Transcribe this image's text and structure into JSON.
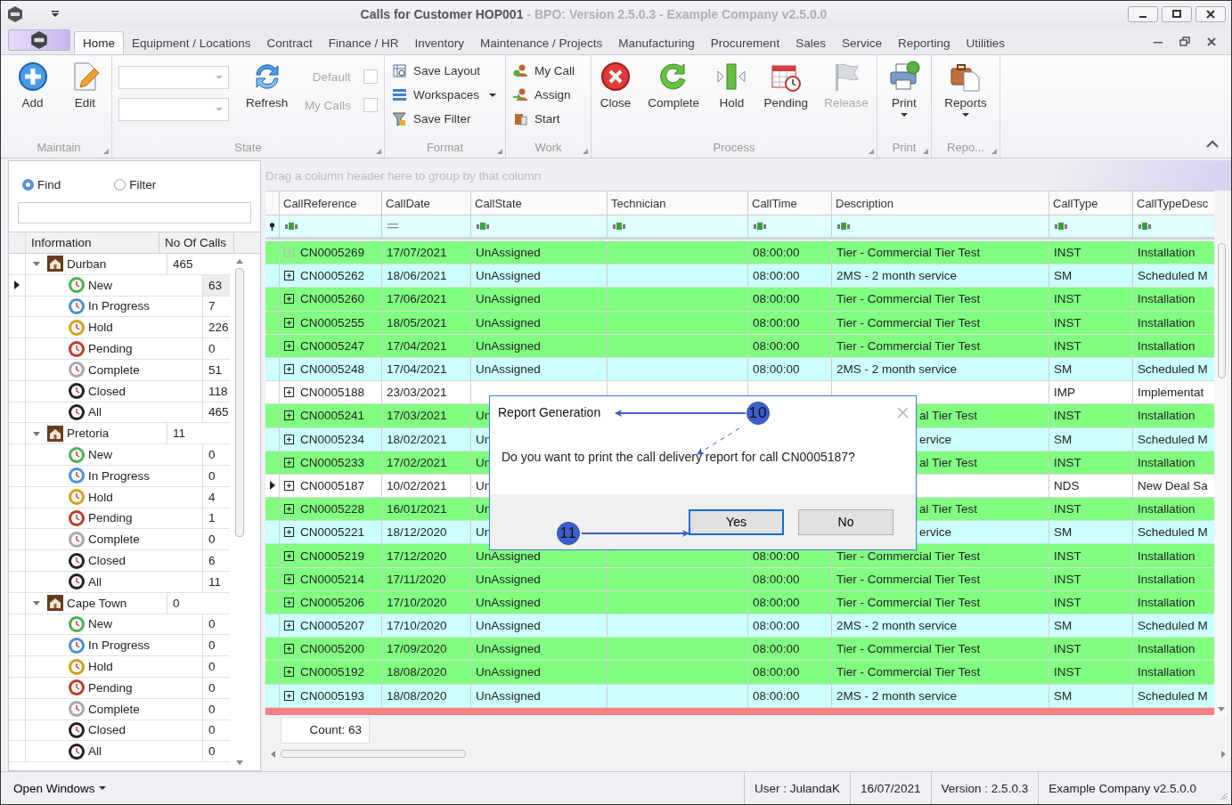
{
  "window": {
    "title": "Calls for Customer HOP001",
    "subtitle": "- BPO: Version 2.5.0.3 - Example Company v2.5.0.0"
  },
  "tabs": [
    {
      "label": "Home",
      "selected": true
    },
    {
      "label": "Equipment / Locations",
      "selected": false
    },
    {
      "label": "Contract",
      "selected": false
    },
    {
      "label": "Finance / HR",
      "selected": false
    },
    {
      "label": "Inventory",
      "selected": false
    },
    {
      "label": "Maintenance / Projects",
      "selected": false
    },
    {
      "label": "Manufacturing",
      "selected": false
    },
    {
      "label": "Procurement",
      "selected": false
    },
    {
      "label": "Sales",
      "selected": false
    },
    {
      "label": "Service",
      "selected": false
    },
    {
      "label": "Reporting",
      "selected": false
    },
    {
      "label": "Utilities",
      "selected": false
    }
  ],
  "ribbon": {
    "maintain": {
      "label": "Maintain",
      "buttons": [
        {
          "label": "Add"
        },
        {
          "label": "Edit"
        }
      ]
    },
    "state": {
      "label": "State",
      "refresh": "Refresh",
      "checks": [
        {
          "label": "Default",
          "checked": false,
          "disabled": true
        },
        {
          "label": "My Calls",
          "checked": false,
          "disabled": true
        }
      ]
    },
    "format": {
      "label": "Format",
      "buttons": [
        {
          "label": "Save Layout",
          "dropdown": false
        },
        {
          "label": "Workspaces",
          "dropdown": true
        },
        {
          "label": "Save Filter",
          "dropdown": false
        }
      ]
    },
    "work": {
      "label": "Work",
      "buttons": [
        {
          "label": "My Call"
        },
        {
          "label": "Assign"
        },
        {
          "label": "Start"
        }
      ]
    },
    "process": {
      "label": "Process",
      "buttons": [
        {
          "label": "Close",
          "disabled": false
        },
        {
          "label": "Complete",
          "disabled": false
        },
        {
          "label": "Hold",
          "disabled": false
        },
        {
          "label": "Pending",
          "disabled": false
        },
        {
          "label": "Release",
          "disabled": true
        }
      ]
    },
    "print": {
      "label": "Print",
      "button": "Print"
    },
    "reports": {
      "label": "Repo...",
      "button": "Reports"
    }
  },
  "search_mode": [
    {
      "label": "Find",
      "selected": true
    },
    {
      "label": "Filter",
      "selected": false
    }
  ],
  "tree": {
    "columns": [
      "Information",
      "No Of Calls"
    ],
    "nodes": [
      {
        "label": "Durban",
        "count": "465",
        "expanded": true,
        "selected": false,
        "children": [
          {
            "label": "New",
            "count": "63",
            "color": "#4caf50",
            "selected": true
          },
          {
            "label": "In Progress",
            "count": "7",
            "color": "#4a90d9",
            "selected": false
          },
          {
            "label": "Hold",
            "count": "226",
            "color": "#d4a017",
            "selected": false
          },
          {
            "label": "Pending",
            "count": "0",
            "color": "#c0392b",
            "selected": false
          },
          {
            "label": "Complete",
            "count": "51",
            "color": "#a8a8a8",
            "selected": false
          },
          {
            "label": "Closed",
            "count": "118",
            "color": "#222222",
            "selected": false
          },
          {
            "label": "All",
            "count": "465",
            "color": "#222222",
            "selected": false
          }
        ]
      },
      {
        "label": "Pretoria",
        "count": "11",
        "expanded": true,
        "selected": false,
        "children": [
          {
            "label": "New",
            "count": "0",
            "color": "#4caf50",
            "selected": false
          },
          {
            "label": "In Progress",
            "count": "0",
            "color": "#4a90d9",
            "selected": false
          },
          {
            "label": "Hold",
            "count": "4",
            "color": "#d4a017",
            "selected": false
          },
          {
            "label": "Pending",
            "count": "1",
            "color": "#c0392b",
            "selected": false
          },
          {
            "label": "Complete",
            "count": "0",
            "color": "#a8a8a8",
            "selected": false
          },
          {
            "label": "Closed",
            "count": "6",
            "color": "#222222",
            "selected": false
          },
          {
            "label": "All",
            "count": "11",
            "color": "#222222",
            "selected": false
          }
        ]
      },
      {
        "label": "Cape Town",
        "count": "0",
        "expanded": true,
        "selected": false,
        "children": [
          {
            "label": "New",
            "count": "0",
            "color": "#4caf50",
            "selected": false
          },
          {
            "label": "In Progress",
            "count": "0",
            "color": "#4a90d9",
            "selected": false
          },
          {
            "label": "Hold",
            "count": "0",
            "color": "#d4a017",
            "selected": false
          },
          {
            "label": "Pending",
            "count": "0",
            "color": "#c0392b",
            "selected": false
          },
          {
            "label": "Complete",
            "count": "0",
            "color": "#a8a8a8",
            "selected": false
          },
          {
            "label": "Closed",
            "count": "0",
            "color": "#222222",
            "selected": false
          },
          {
            "label": "All",
            "count": "0",
            "color": "#222222",
            "selected": false
          }
        ]
      }
    ]
  },
  "grid": {
    "group_hint": "Drag a column header here to group by that column",
    "columns": [
      {
        "label": "CallReference",
        "kind": "text"
      },
      {
        "label": "CallDate",
        "kind": "date"
      },
      {
        "label": "CallState",
        "kind": "text"
      },
      {
        "label": "Technician",
        "kind": "text"
      },
      {
        "label": "CallTime",
        "kind": "text"
      },
      {
        "label": "Description",
        "kind": "text"
      },
      {
        "label": "CallType",
        "kind": "text"
      },
      {
        "label": "CallTypeDesc",
        "kind": "text"
      }
    ],
    "rows": [
      {
        "reference": "CN0005269",
        "date": "17/07/2021",
        "state": "UnAssigned",
        "time": "08:00:00",
        "description": "Tier - Commercial Tier Test",
        "type": "INST",
        "type_desc": "Installation",
        "color": "#80ff80",
        "selected": false,
        "expandable": false
      },
      {
        "reference": "CN0005262",
        "date": "18/06/2021",
        "state": "UnAssigned",
        "time": "08:00:00",
        "description": "2MS - 2 month service",
        "type": "SM",
        "type_desc": "Scheduled M",
        "color": "#ccffff",
        "selected": false,
        "expandable": true
      },
      {
        "reference": "CN0005260",
        "date": "17/06/2021",
        "state": "UnAssigned",
        "time": "08:00:00",
        "description": "Tier - Commercial Tier Test",
        "type": "INST",
        "type_desc": "Installation",
        "color": "#80ff80",
        "selected": false,
        "expandable": true
      },
      {
        "reference": "CN0005255",
        "date": "18/05/2021",
        "state": "UnAssigned",
        "time": "08:00:00",
        "description": "Tier - Commercial Tier Test",
        "type": "INST",
        "type_desc": "Installation",
        "color": "#80ff80",
        "selected": false,
        "expandable": true
      },
      {
        "reference": "CN0005247",
        "date": "17/04/2021",
        "state": "UnAssigned",
        "time": "08:00:00",
        "description": "Tier - Commercial Tier Test",
        "type": "INST",
        "type_desc": "Installation",
        "color": "#80ff80",
        "selected": false,
        "expandable": true
      },
      {
        "reference": "CN0005248",
        "date": "17/04/2021",
        "state": "UnAssigned",
        "time": "08:00:00",
        "description": "2MS - 2 month service",
        "type": "SM",
        "type_desc": "Scheduled M",
        "color": "#ccffff",
        "selected": false,
        "expandable": true
      },
      {
        "reference": "CN0005188",
        "date": "23/03/2021",
        "type": "IMP",
        "type_desc": "Implementat",
        "color": "#ffffff",
        "selected": false,
        "expandable": true
      },
      {
        "reference": "CN0005241",
        "date": "17/03/2021",
        "state": "Un",
        "description_tail": "al Tier Test",
        "type": "INST",
        "type_desc": "Installation",
        "color": "#80ff80",
        "selected": false,
        "expandable": true
      },
      {
        "reference": "CN0005234",
        "date": "18/02/2021",
        "state": "Un",
        "description_tail": "ervice",
        "type": "SM",
        "type_desc": "Scheduled M",
        "color": "#ccffff",
        "selected": false,
        "expandable": true
      },
      {
        "reference": "CN0005233",
        "date": "17/02/2021",
        "state": "Un",
        "description_tail": "al Tier Test",
        "type": "INST",
        "type_desc": "Installation",
        "color": "#80ff80",
        "selected": false,
        "expandable": true
      },
      {
        "reference": "CN0005187",
        "date": "10/02/2021",
        "state": "Un",
        "type": "NDS",
        "type_desc": "New Deal Sa",
        "color": "#ffffff",
        "selected": true,
        "expandable": true
      },
      {
        "reference": "CN0005228",
        "date": "16/01/2021",
        "state": "Un",
        "description_tail": "al Tier Test",
        "type": "INST",
        "type_desc": "Installation",
        "color": "#80ff80",
        "selected": false,
        "expandable": true
      },
      {
        "reference": "CN0005221",
        "date": "18/12/2020",
        "state": "Un",
        "description_tail": "ervice",
        "type": "SM",
        "type_desc": "Scheduled M",
        "color": "#ccffff",
        "selected": false,
        "expandable": true
      },
      {
        "reference": "CN0005219",
        "date": "17/12/2020",
        "state": "UnAssigned",
        "time": "08:00:00",
        "description": "Tier - Commercial Tier Test",
        "type": "INST",
        "type_desc": "Installation",
        "color": "#80ff80",
        "selected": false,
        "expandable": true
      },
      {
        "reference": "CN0005214",
        "date": "17/11/2020",
        "state": "UnAssigned",
        "time": "08:00:00",
        "description": "Tier - Commercial Tier Test",
        "type": "INST",
        "type_desc": "Installation",
        "color": "#80ff80",
        "selected": false,
        "expandable": true
      },
      {
        "reference": "CN0005206",
        "date": "17/10/2020",
        "state": "UnAssigned",
        "time": "08:00:00",
        "description": "Tier - Commercial Tier Test",
        "type": "INST",
        "type_desc": "Installation",
        "color": "#80ff80",
        "selected": false,
        "expandable": true
      },
      {
        "reference": "CN0005207",
        "date": "17/10/2020",
        "state": "UnAssigned",
        "time": "08:00:00",
        "description": "2MS - 2 month service",
        "type": "SM",
        "type_desc": "Scheduled M",
        "color": "#ccffff",
        "selected": false,
        "expandable": true
      },
      {
        "reference": "CN0005200",
        "date": "17/09/2020",
        "state": "UnAssigned",
        "time": "08:00:00",
        "description": "Tier - Commercial Tier Test",
        "type": "INST",
        "type_desc": "Installation",
        "color": "#80ff80",
        "selected": false,
        "expandable": true
      },
      {
        "reference": "CN0005192",
        "date": "18/08/2020",
        "state": "UnAssigned",
        "time": "08:00:00",
        "description": "Tier - Commercial Tier Test",
        "type": "INST",
        "type_desc": "Installation",
        "color": "#80ff80",
        "selected": false,
        "expandable": true
      },
      {
        "reference": "CN0005193",
        "date": "18/08/2020",
        "state": "UnAssigned",
        "time": "08:00:00",
        "description": "2MS - 2 month service",
        "type": "SM",
        "type_desc": "Scheduled M",
        "color": "#ccffff",
        "selected": false,
        "expandable": true
      }
    ],
    "count": "Count: 63"
  },
  "dialog": {
    "title": "Report Generation",
    "message": "Do you want to print the call delivery report for call CN0005187?",
    "buttons": [
      {
        "label": "Yes",
        "focused": true
      },
      {
        "label": "No",
        "focused": false
      }
    ]
  },
  "annotations": [
    {
      "number": "10"
    },
    {
      "number": "11"
    }
  ],
  "status_bar": {
    "open_windows": "Open Windows",
    "fields": [
      "User : JulandaK",
      "16/07/2021",
      "Version : 2.5.0.3",
      "Example Company v2.5.0.0"
    ]
  }
}
